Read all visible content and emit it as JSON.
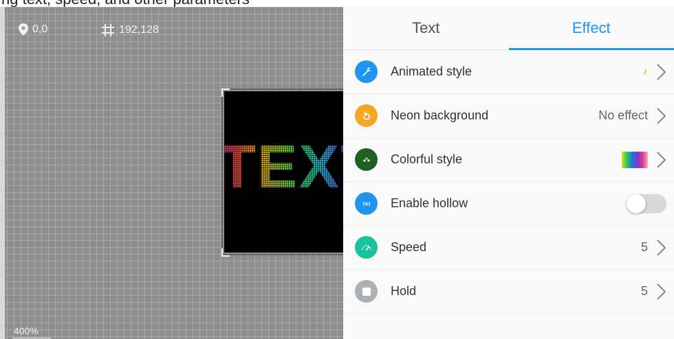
{
  "top_strip_text": "ng text, speed, and other parameters",
  "canvas": {
    "position_readout": "0,0",
    "size_readout": "192,128",
    "zoom_level": "400%",
    "led_text": "TEXT"
  },
  "tabs": [
    {
      "label": "Text",
      "active": false
    },
    {
      "label": "Effect",
      "active": true
    }
  ],
  "settings": [
    {
      "label": "Animated style",
      "value": "",
      "icon": "magic-wand-icon",
      "icon_color": "#1e96f0"
    },
    {
      "label": "Neon background",
      "value": "No effect",
      "icon": "rotate-icon",
      "icon_color": "#f5a623"
    },
    {
      "label": "Colorful style",
      "value": "",
      "icon": "palette-icon",
      "icon_color": "#1f5f1f"
    },
    {
      "label": "Enable hollow",
      "value": "",
      "icon": "hollow-frame-icon",
      "icon_color": "#1e96f0",
      "toggle": false
    },
    {
      "label": "Speed",
      "value": "5",
      "icon": "speedometer-icon",
      "icon_color": "#18c29c"
    },
    {
      "label": "Hold",
      "value": "5",
      "icon": "stop-icon",
      "icon_color": "#aab0b3"
    }
  ],
  "colors": {
    "accent": "#1e96f0",
    "canvas_bg": "#8e8e8e",
    "panel_bg": "#f9f9f9"
  }
}
